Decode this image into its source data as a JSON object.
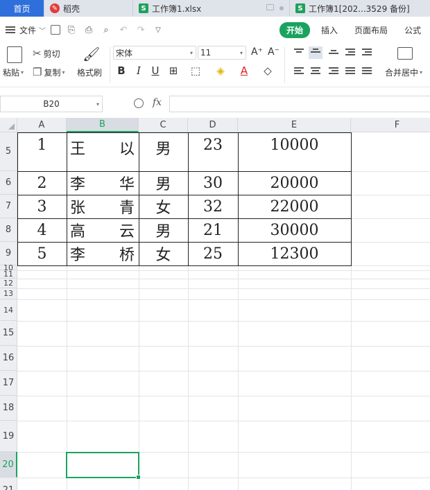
{
  "tabs": [
    {
      "label": "首页",
      "type": "home"
    },
    {
      "label": "稻壳",
      "type": "daoke"
    },
    {
      "label": "工作簿1.xlsx",
      "type": "sheet"
    },
    {
      "label": "工作簿1[202...3529 备份]",
      "type": "sheet"
    }
  ],
  "menu": {
    "file_label": "文件",
    "tabs": [
      "开始",
      "插入",
      "页面布局",
      "公式"
    ],
    "active_tab": "开始"
  },
  "ribbon": {
    "paste": "粘贴",
    "cut": "剪切",
    "copy": "复制",
    "format_painter": "格式刷",
    "font_name": "宋体",
    "font_size": "11",
    "bold": "B",
    "italic": "I",
    "underline": "U",
    "merge_center": "合并居中"
  },
  "formula_bar": {
    "cell_ref": "B20",
    "fx": "fx",
    "content": ""
  },
  "columns": [
    "A",
    "B",
    "C",
    "D",
    "E",
    "F"
  ],
  "selected_column": "B",
  "rows": [
    "5",
    "6",
    "7",
    "8",
    "9",
    "10",
    "11",
    "12",
    "13",
    "14",
    "15",
    "16",
    "17",
    "18",
    "19",
    "20",
    "21"
  ],
  "selected_row": "20",
  "table": [
    {
      "id": "1",
      "name": [
        "王",
        "以"
      ],
      "gender": "男",
      "age": "23",
      "amount": "10000"
    },
    {
      "id": "2",
      "name": [
        "李",
        "华"
      ],
      "gender": "男",
      "age": "30",
      "amount": "20000"
    },
    {
      "id": "3",
      "name": [
        "张",
        "青"
      ],
      "gender": "女",
      "age": "32",
      "amount": "22000"
    },
    {
      "id": "4",
      "name": [
        "高",
        "云"
      ],
      "gender": "男",
      "age": "21",
      "amount": "30000"
    },
    {
      "id": "5",
      "name": [
        "李",
        "桥"
      ],
      "gender": "女",
      "age": "25",
      "amount": "12300"
    }
  ]
}
